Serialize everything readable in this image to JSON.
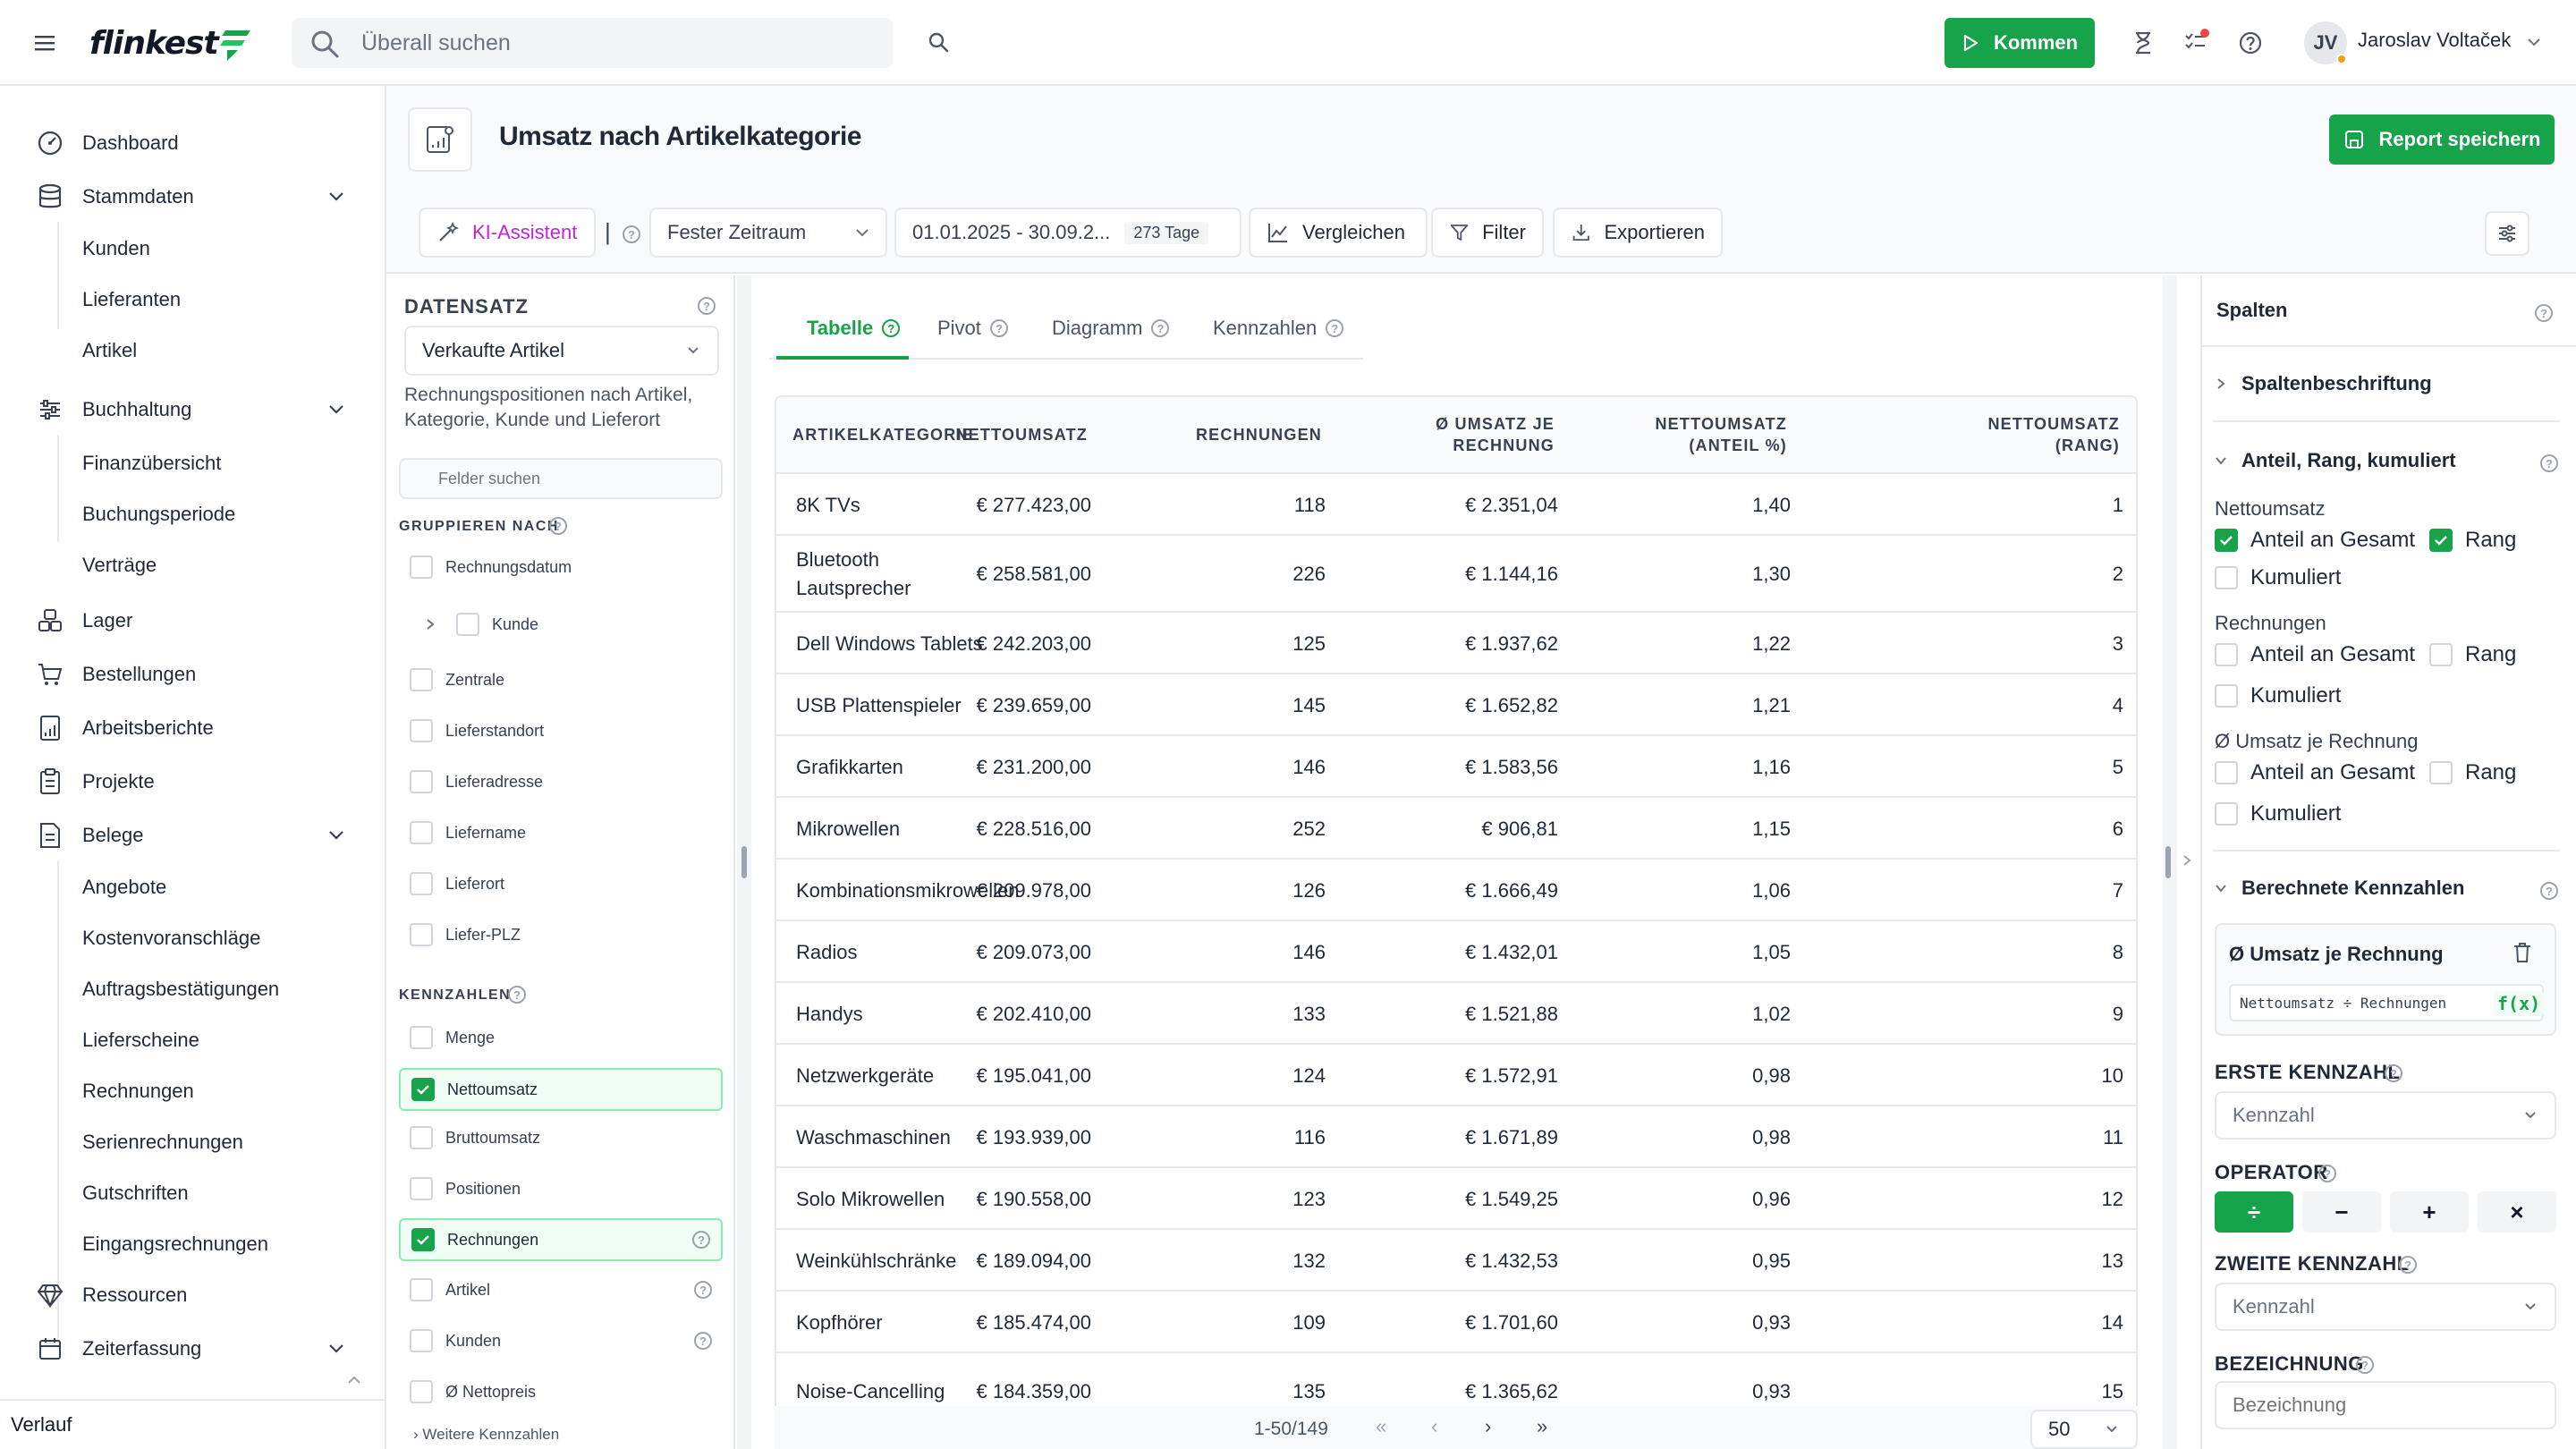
{
  "app": {
    "logo": "flinkest"
  },
  "topbar": {
    "search_placeholder": "Überall suchen",
    "kommen_label": "Kommen",
    "user": {
      "initials": "JV",
      "name": "Jaroslav Voltaček"
    }
  },
  "sidebar": {
    "items": [
      {
        "label": "Dashboard"
      },
      {
        "label": "Stammdaten",
        "children": [
          "Kunden",
          "Lieferanten",
          "Artikel"
        ]
      },
      {
        "label": "Buchhaltung",
        "children": [
          "Finanzübersicht",
          "Buchungsperiode",
          "Verträge"
        ]
      },
      {
        "label": "Lager"
      },
      {
        "label": "Bestellungen"
      },
      {
        "label": "Arbeitsberichte"
      },
      {
        "label": "Projekte"
      },
      {
        "label": "Belege",
        "children": [
          "Angebote",
          "Kostenvoranschläge",
          "Auftragsbestätigungen",
          "Lieferscheine",
          "Rechnungen",
          "Serienrechnungen",
          "Gutschriften",
          "Eingangsrechnungen"
        ]
      },
      {
        "label": "Ressourcen"
      },
      {
        "label": "Zeiterfassung"
      }
    ],
    "footer": "Verlauf"
  },
  "page": {
    "title": "Umsatz nach Artikelkategorie",
    "save_label": "Report speichern"
  },
  "toolbar": {
    "ki_label": "KI-Assistent",
    "separator": "|",
    "period_label": "Fester Zeitraum",
    "date_range": "01.01.2025 - 30.09.2...",
    "days_badge": "273 Tage",
    "compare_label": "Vergleichen",
    "filter_label": "Filter",
    "export_label": "Exportieren"
  },
  "dataset": {
    "title": "DATENSATZ",
    "selected": "Verkaufte Artikel",
    "description": "Rechnungspositionen nach Artikel, Kategorie, Kunde und Lieferort",
    "search_placeholder": "Felder suchen",
    "group_label": "GRUPPIEREN NACH",
    "group_fields": [
      "Rechnungsdatum",
      "Kunde",
      "Zentrale",
      "Lieferstandort",
      "Lieferadresse",
      "Liefername",
      "Lieferort",
      "Liefer-PLZ"
    ],
    "metrics_label": "KENNZAHLEN",
    "metric_fields": [
      {
        "label": "Menge",
        "checked": false
      },
      {
        "label": "Nettoumsatz",
        "checked": true
      },
      {
        "label": "Bruttoumsatz",
        "checked": false
      },
      {
        "label": "Positionen",
        "checked": false
      },
      {
        "label": "Rechnungen",
        "checked": true
      },
      {
        "label": "Artikel",
        "checked": false
      },
      {
        "label": "Kunden",
        "checked": false
      },
      {
        "label": "Ø Nettopreis",
        "checked": false
      }
    ],
    "more_label": "Weitere Kennzahlen"
  },
  "tabs": [
    "Tabelle",
    "Pivot",
    "Diagramm",
    "Kennzahlen"
  ],
  "table": {
    "columns": [
      [
        "ARTIKELKATEGORIE"
      ],
      [
        "NETTOUMSATZ"
      ],
      [
        "RECHNUNGEN"
      ],
      [
        "Ø UMSATZ JE",
        "RECHNUNG"
      ],
      [
        "NETTOUMSATZ",
        "(ANTEIL %)"
      ],
      [
        "NETTOUMSATZ",
        "(RANG)"
      ]
    ],
    "rows": [
      [
        "8K TVs",
        "€ 277.423,00",
        "118",
        "€ 2.351,04",
        "1,40",
        "1"
      ],
      [
        "Bluetooth Lautsprecher",
        "€ 258.581,00",
        "226",
        "€ 1.144,16",
        "1,30",
        "2"
      ],
      [
        "Dell Windows Tablets",
        "€ 242.203,00",
        "125",
        "€ 1.937,62",
        "1,22",
        "3"
      ],
      [
        "USB Plattenspieler",
        "€ 239.659,00",
        "145",
        "€ 1.652,82",
        "1,21",
        "4"
      ],
      [
        "Grafikkarten",
        "€ 231.200,00",
        "146",
        "€ 1.583,56",
        "1,16",
        "5"
      ],
      [
        "Mikrowellen",
        "€ 228.516,00",
        "252",
        "€ 906,81",
        "1,15",
        "6"
      ],
      [
        "Kombinationsmikrowellen",
        "€ 209.978,00",
        "126",
        "€ 1.666,49",
        "1,06",
        "7"
      ],
      [
        "Radios",
        "€ 209.073,00",
        "146",
        "€ 1.432,01",
        "1,05",
        "8"
      ],
      [
        "Handys",
        "€ 202.410,00",
        "133",
        "€ 1.521,88",
        "1,02",
        "9"
      ],
      [
        "Netzwerkgeräte",
        "€ 195.041,00",
        "124",
        "€ 1.572,91",
        "0,98",
        "10"
      ],
      [
        "Waschmaschinen",
        "€ 193.939,00",
        "116",
        "€ 1.671,89",
        "0,98",
        "11"
      ],
      [
        "Solo Mikrowellen",
        "€ 190.558,00",
        "123",
        "€ 1.549,25",
        "0,96",
        "12"
      ],
      [
        "Weinkühlschränke",
        "€ 189.094,00",
        "132",
        "€ 1.432,53",
        "0,95",
        "13"
      ],
      [
        "Kopfhörer",
        "€ 185.474,00",
        "109",
        "€ 1.701,60",
        "0,93",
        "14"
      ],
      [
        "Noise-Cancelling",
        "€ 184.359,00",
        "135",
        "€ 1.365,62",
        "0,93",
        "15"
      ]
    ],
    "pager": {
      "range": "1-50/149",
      "page_size": "50"
    }
  },
  "right_panel": {
    "title": "Spalten",
    "labels_section": "Spaltenbeschriftung",
    "share_section": "Anteil, Rang, kumuliert",
    "groups": [
      {
        "name": "Nettoumsatz",
        "share": true,
        "rank": true,
        "cumulative": false
      },
      {
        "name": "Rechnungen",
        "share": false,
        "rank": false,
        "cumulative": false
      },
      {
        "name": "Ø Umsatz je Rechnung",
        "share": false,
        "rank": false,
        "cumulative": false
      }
    ],
    "opt_share": "Anteil an Gesamt",
    "opt_rank": "Rang",
    "opt_cumulative": "Kumuliert",
    "calc_section": "Berechnete Kennzahlen",
    "calc_item": {
      "name": "Ø Umsatz je Rechnung",
      "formula": "Nettoumsatz ÷ Rechnungen",
      "fx": "f(x)"
    },
    "first_metric_label": "ERSTE KENNZAHL",
    "first_metric_placeholder": "Kennzahl",
    "operator_label": "OPERATOR",
    "operators": [
      "÷",
      "−",
      "+",
      "×"
    ],
    "second_metric_label": "ZWEITE KENNZAHL",
    "second_metric_placeholder": "Kennzahl",
    "name_label": "BEZEICHNUNG",
    "name_placeholder": "Bezeichnung"
  },
  "colors": {
    "accent": "#16a34a",
    "accent_light": "#f0fdf4",
    "border": "#e5e7eb"
  }
}
